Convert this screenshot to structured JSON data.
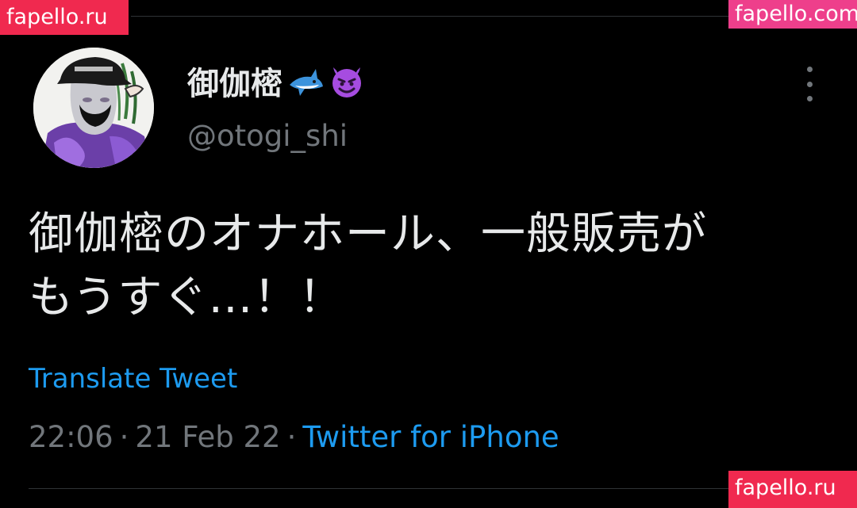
{
  "watermarks": {
    "top_left": "fapello.ru",
    "top_right": "fapello.com",
    "bottom_right": "fapello.ru"
  },
  "tweet": {
    "display_name": "御伽樒",
    "name_emojis": [
      "shark-emoji",
      "smiling-devil-emoji"
    ],
    "username": "@otogi_shi",
    "text_lines": [
      "御伽樒のオナホール、一般販売が",
      "もうすぐ…！！"
    ],
    "translate_label": "Translate Tweet",
    "time": "22:06",
    "separator": "·",
    "date": "21 Feb 22",
    "source": "Twitter for iPhone"
  },
  "colors": {
    "background": "#000000",
    "text_primary": "#e7e9ea",
    "text_secondary": "#71767b",
    "link": "#1d9bf0",
    "watermark_red": "#f0294f",
    "watermark_pink": "#ee3f8b"
  },
  "icons": {
    "more": "more-vertical-icon"
  }
}
